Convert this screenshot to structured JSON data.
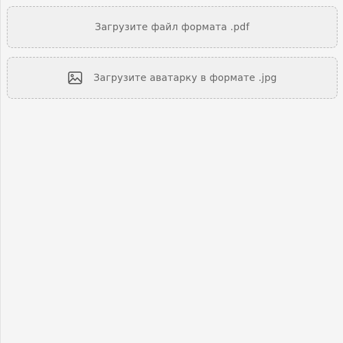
{
  "upload_pdf": {
    "label": "Загрузите файл формата .pdf"
  },
  "upload_avatar": {
    "label": "Загрузите аватарку в формате .jpg",
    "icon": "image-icon"
  },
  "colors": {
    "background": "#f5f5f5",
    "dropzone_background": "#f0f0f0",
    "dropzone_border": "#b9b9b9",
    "text": "#666666"
  }
}
